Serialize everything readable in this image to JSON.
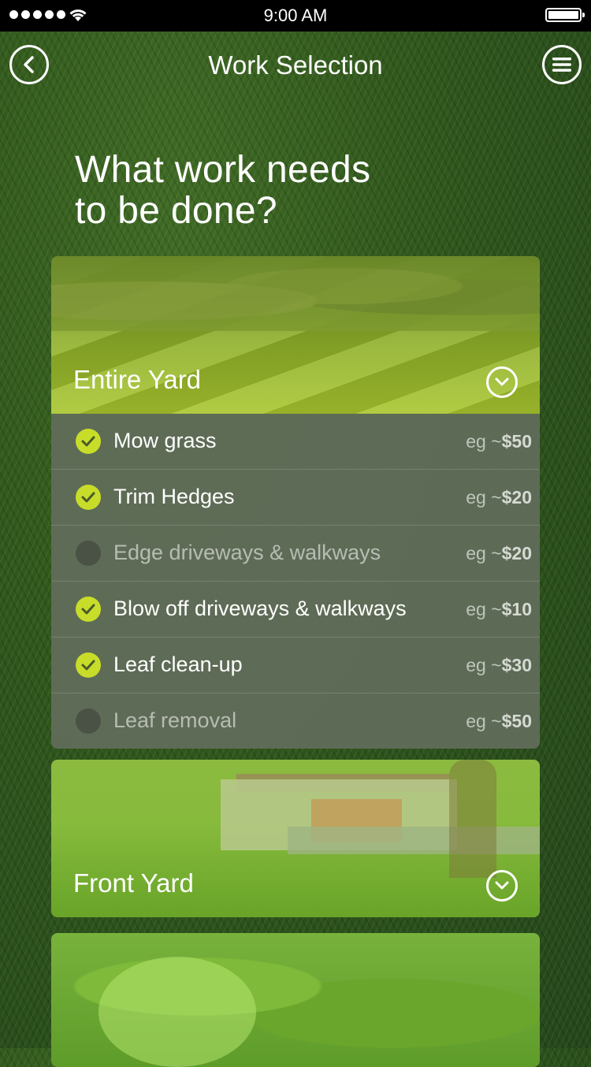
{
  "status_bar": {
    "time": "9:00 AM",
    "signal_dots": 5
  },
  "nav": {
    "title": "Work Selection",
    "back_icon": "chevron-left-circle-icon",
    "menu_icon": "hamburger-circle-icon"
  },
  "headline": {
    "line1": "What work needs",
    "line2": "to be done?"
  },
  "sections": {
    "entire": {
      "label": "Entire Yard",
      "expanded": true,
      "tasks": [
        {
          "label": "Mow grass",
          "checked": true,
          "price_prefix": "eg ~",
          "price": "$50"
        },
        {
          "label": "Trim Hedges",
          "checked": true,
          "price_prefix": "eg ~",
          "price": "$20"
        },
        {
          "label": "Edge driveways & walkways",
          "checked": false,
          "price_prefix": "eg ~",
          "price": "$20"
        },
        {
          "label": "Blow off driveways & walkways",
          "checked": true,
          "price_prefix": "eg ~",
          "price": "$10"
        },
        {
          "label": "Leaf clean-up",
          "checked": true,
          "price_prefix": "eg ~",
          "price": "$30"
        },
        {
          "label": "Leaf removal",
          "checked": false,
          "price_prefix": "eg ~",
          "price": "$50"
        }
      ]
    },
    "front": {
      "label": "Front Yard",
      "expanded": false
    },
    "back": {
      "label": "",
      "expanded": false
    }
  },
  "colors": {
    "check_on": "#c7dd29",
    "check_off": "#4a5246",
    "task_panel": "#606c58",
    "status_bar": "#000000"
  }
}
